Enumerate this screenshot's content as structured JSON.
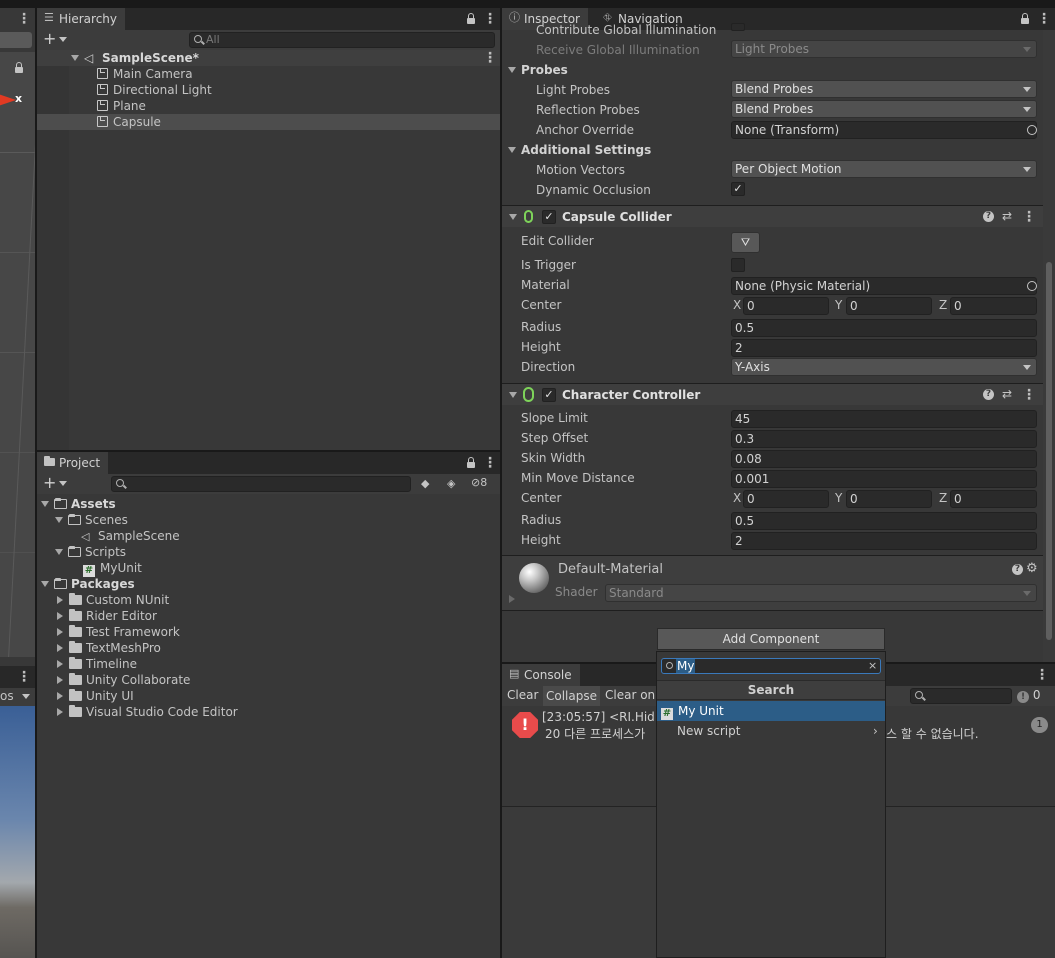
{
  "hierarchy": {
    "tab_label": "Hierarchy",
    "search_placeholder": "All",
    "scene_name": "SampleScene*",
    "objects": [
      "Main Camera",
      "Directional Light",
      "Plane",
      "Capsule"
    ],
    "selected": "Capsule"
  },
  "scene_view": {
    "axis_label": "x",
    "left_bottom_label": "os"
  },
  "project": {
    "tab_label": "Project",
    "hidden_count": "8",
    "tree": {
      "assets": "Assets",
      "scenes": "Scenes",
      "sample_scene": "SampleScene",
      "scripts": "Scripts",
      "my_unit": "MyUnit",
      "packages": "Packages",
      "package_items": [
        "Custom NUnit",
        "Rider Editor",
        "Test Framework",
        "TextMeshPro",
        "Timeline",
        "Unity Collaborate",
        "Unity UI",
        "Visual Studio Code Editor"
      ]
    }
  },
  "inspector": {
    "tab_label": "Inspector",
    "nav_tab_label": "Navigation",
    "lighting": {
      "contribute_gi": "Contribute Global Illumination",
      "receive_gi": "Receive Global Illumination",
      "receive_gi_value": "Light Probes"
    },
    "probes": {
      "header": "Probes",
      "light_probes": "Light Probes",
      "light_probes_value": "Blend Probes",
      "reflection_probes": "Reflection Probes",
      "reflection_probes_value": "Blend Probes",
      "anchor_override": "Anchor Override",
      "anchor_override_value": "None (Transform)"
    },
    "additional": {
      "header": "Additional Settings",
      "motion_vectors": "Motion Vectors",
      "motion_vectors_value": "Per Object Motion",
      "dynamic_occlusion": "Dynamic Occlusion",
      "dynamic_occlusion_checked": true
    },
    "capsule_collider": {
      "title": "Capsule Collider",
      "edit_collider": "Edit Collider",
      "is_trigger": "Is Trigger",
      "material": "Material",
      "material_value": "None (Physic Material)",
      "center": "Center",
      "center_x_label": "X",
      "center_x": "0",
      "center_y_label": "Y",
      "center_y": "0",
      "center_z_label": "Z",
      "center_z": "0",
      "radius": "Radius",
      "radius_value": "0.5",
      "height": "Height",
      "height_value": "2",
      "direction": "Direction",
      "direction_value": "Y-Axis"
    },
    "character_controller": {
      "title": "Character Controller",
      "slope_limit": "Slope Limit",
      "slope_limit_value": "45",
      "step_offset": "Step Offset",
      "step_offset_value": "0.3",
      "skin_width": "Skin Width",
      "skin_width_value": "0.08",
      "min_move_distance": "Min Move Distance",
      "min_move_distance_value": "0.001",
      "center": "Center",
      "center_x_label": "X",
      "center_x": "0",
      "center_y_label": "Y",
      "center_y": "0",
      "center_z_label": "Z",
      "center_z": "0",
      "radius": "Radius",
      "radius_value": "0.5",
      "height": "Height",
      "height_value": "2"
    },
    "material": {
      "name": "Default-Material",
      "shader_label": "Shader",
      "shader_value": "Standard"
    }
  },
  "add_component": {
    "button_label": "Add Component",
    "search_value": "My",
    "header": "Search",
    "results": [
      "My Unit",
      "New script"
    ]
  },
  "console": {
    "tab_label": "Console",
    "clear": "Clear",
    "collapse": "Collapse",
    "clear_on": "Clear on",
    "error_count": "0",
    "message_line1": "[23:05:57] <RI.Hid>",
    "message_line2": "20 다른 프로세스가",
    "message_tail": "스 할 수 없습니다.",
    "message_count": "1"
  },
  "colors": {
    "selected_row": "#4d4d4d",
    "highlight": "#2c5d87",
    "error": "#e84b4b"
  }
}
